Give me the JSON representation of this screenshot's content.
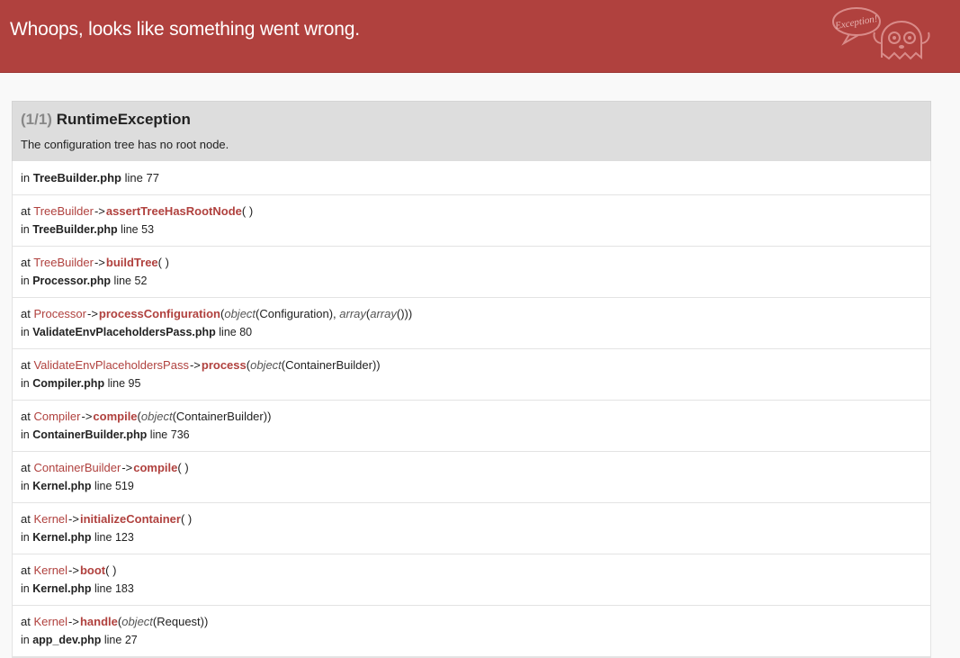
{
  "header": {
    "title": "Whoops, looks like something went wrong.",
    "logo_text": "Exception!",
    "bg_color": "#b0413e"
  },
  "exception": {
    "count": "(1/1)",
    "class": "RuntimeException",
    "message": "The configuration tree has no root node."
  },
  "first_location": {
    "in_label": "in",
    "file": "TreeBuilder.php",
    "line_label": "line",
    "line": "77"
  },
  "frames": [
    {
      "at": "at",
      "class": "TreeBuilder",
      "arrow": "->",
      "method": "assertTreeHasRootNode",
      "args": [],
      "in": "in",
      "file": "TreeBuilder.php",
      "line_label": "line",
      "line": "53"
    },
    {
      "at": "at",
      "class": "TreeBuilder",
      "arrow": "->",
      "method": "buildTree",
      "args": [],
      "in": "in",
      "file": "Processor.php",
      "line_label": "line",
      "line": "52"
    },
    {
      "at": "at",
      "class": "Processor",
      "arrow": "->",
      "method": "processConfiguration",
      "args": [
        {
          "type": "object",
          "value": "(Configuration)"
        },
        {
          "sep": ", "
        },
        {
          "type": "array",
          "value": "("
        },
        {
          "type": "array",
          "value": "()"
        },
        {
          "plain": ")"
        }
      ],
      "in": "in",
      "file": "ValidateEnvPlaceholdersPass.php",
      "line_label": "line",
      "line": "80"
    },
    {
      "at": "at",
      "class": "ValidateEnvPlaceholdersPass",
      "arrow": "->",
      "method": "process",
      "args": [
        {
          "type": "object",
          "value": "(ContainerBuilder)"
        }
      ],
      "in": "in",
      "file": "Compiler.php",
      "line_label": "line",
      "line": "95"
    },
    {
      "at": "at",
      "class": "Compiler",
      "arrow": "->",
      "method": "compile",
      "args": [
        {
          "type": "object",
          "value": "(ContainerBuilder)"
        }
      ],
      "in": "in",
      "file": "ContainerBuilder.php",
      "line_label": "line",
      "line": "736"
    },
    {
      "at": "at",
      "class": "ContainerBuilder",
      "arrow": "->",
      "method": "compile",
      "args": [],
      "in": "in",
      "file": "Kernel.php",
      "line_label": "line",
      "line": "519"
    },
    {
      "at": "at",
      "class": "Kernel",
      "arrow": "->",
      "method": "initializeContainer",
      "args": [],
      "in": "in",
      "file": "Kernel.php",
      "line_label": "line",
      "line": "123"
    },
    {
      "at": "at",
      "class": "Kernel",
      "arrow": "->",
      "method": "boot",
      "args": [],
      "in": "in",
      "file": "Kernel.php",
      "line_label": "line",
      "line": "183"
    },
    {
      "at": "at",
      "class": "Kernel",
      "arrow": "->",
      "method": "handle",
      "args": [
        {
          "type": "object",
          "value": "(Request)"
        }
      ],
      "in": "in",
      "file": "app_dev.php",
      "line_label": "line",
      "line": "27"
    }
  ]
}
